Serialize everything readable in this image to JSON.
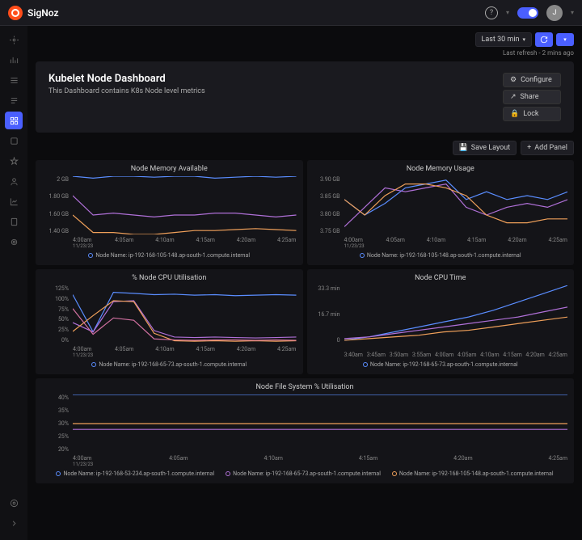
{
  "brand": "SigNoz",
  "avatar_initial": "J",
  "time_range": "Last 30 min",
  "last_refresh": "Last refresh - 2 mins ago",
  "dashboard": {
    "title": "Kubelet Node Dashboard",
    "subtitle": "This Dashboard contains K8s Node level metrics"
  },
  "actions": {
    "configure": "Configure",
    "share": "Share",
    "lock": "Lock",
    "save_layout": "Save Layout",
    "add_panel": "Add Panel"
  },
  "colors": {
    "blue": "#5a8dff",
    "purple": "#b070d8",
    "orange": "#f0a05a",
    "pink": "#d070a0"
  },
  "chart_data": [
    {
      "id": "mem_avail",
      "title": "Node Memory Available",
      "type": "line",
      "yticks": [
        "2 GB",
        "1.80 GB",
        "1.60 GB",
        "1.40 GB"
      ],
      "xticks": [
        "4:00am",
        "4:05am",
        "4:10am",
        "4:15am",
        "4:20am",
        "4:25am"
      ],
      "xdate": "11/23/23",
      "series": [
        {
          "name": "Node Name: ip-192-168-105-148.ap-south-1.compute.internal",
          "color": "blue",
          "values": [
            2.0,
            1.98,
            2.0,
            2.0,
            1.99,
            2.0,
            2.0,
            1.98,
            1.99,
            2.0,
            1.99,
            2.0
          ]
        },
        {
          "name": "",
          "color": "purple",
          "values": [
            1.8,
            1.6,
            1.62,
            1.6,
            1.58,
            1.6,
            1.6,
            1.62,
            1.62,
            1.6,
            1.58,
            1.6
          ]
        },
        {
          "name": "",
          "color": "orange",
          "values": [
            1.6,
            1.42,
            1.42,
            1.4,
            1.4,
            1.42,
            1.44,
            1.44,
            1.45,
            1.46,
            1.45,
            1.44
          ]
        }
      ],
      "ymin": 1.4,
      "ymax": 2.0
    },
    {
      "id": "mem_usage",
      "title": "Node Memory Usage",
      "type": "line",
      "yticks": [
        "3.90 GB",
        "3.85 GB",
        "3.80 GB",
        "3.75 GB"
      ],
      "xticks": [
        "4:00am",
        "4:05am",
        "4:10am",
        "4:15am",
        "4:20am",
        "4:25am"
      ],
      "xdate": "11/23/23",
      "series": [
        {
          "name": "Node Name: ip-192-168-105-148.ap-south-1.compute.internal",
          "color": "blue",
          "values": [
            3.84,
            3.8,
            3.83,
            3.87,
            3.88,
            3.89,
            3.84,
            3.86,
            3.84,
            3.85,
            3.84,
            3.86
          ]
        },
        {
          "name": "",
          "color": "purple",
          "values": [
            3.77,
            3.82,
            3.87,
            3.86,
            3.87,
            3.88,
            3.82,
            3.8,
            3.82,
            3.83,
            3.82,
            3.84
          ]
        },
        {
          "name": "",
          "color": "orange",
          "values": [
            3.84,
            3.8,
            3.85,
            3.88,
            3.88,
            3.87,
            3.85,
            3.8,
            3.78,
            3.78,
            3.79,
            3.79
          ]
        }
      ],
      "ymin": 3.75,
      "ymax": 3.9
    },
    {
      "id": "cpu_util",
      "title": "% Node CPU Utilisation",
      "type": "line",
      "yticks": [
        "125%",
        "100%",
        "75%",
        "50%",
        "25%",
        "0%"
      ],
      "xticks": [
        "4:00am",
        "4:05am",
        "4:10am",
        "4:15am",
        "4:20am",
        "4:25am"
      ],
      "xdate": "11/23/23",
      "series": [
        {
          "name": "Node Name: ip-192-168-65-73.ap-south-1.compute.internal",
          "color": "blue",
          "values": [
            105,
            25,
            110,
            108,
            105,
            106,
            104,
            105,
            103,
            104,
            105,
            104
          ]
        },
        {
          "name": "",
          "color": "purple",
          "values": [
            45,
            25,
            90,
            92,
            28,
            14,
            13,
            14,
            13,
            12,
            13,
            14
          ]
        },
        {
          "name": "",
          "color": "orange",
          "values": [
            26,
            60,
            92,
            90,
            22,
            6,
            5,
            6,
            5,
            6,
            5,
            6
          ]
        },
        {
          "name": "",
          "color": "pink",
          "values": [
            75,
            20,
            55,
            50,
            10,
            8,
            7,
            8,
            8,
            7,
            8,
            7
          ]
        }
      ],
      "ymin": 0,
      "ymax": 125
    },
    {
      "id": "cpu_time",
      "title": "Node CPU Time",
      "type": "line",
      "yticks": [
        "33.3 min",
        "16.7 min",
        "0"
      ],
      "xticks": [
        "3:40am",
        "3:45am",
        "3:50am",
        "3:55am",
        "4:00am",
        "4:05am",
        "4:10am",
        "4:15am",
        "4:20am",
        "4:25am"
      ],
      "series": [
        {
          "name": "Node Name: ip-192-168-65-73.ap-south-1.compute.internal",
          "color": "blue",
          "values": [
            2,
            4,
            7,
            10,
            13,
            16,
            20,
            25,
            30,
            35
          ]
        },
        {
          "name": "",
          "color": "purple",
          "values": [
            3,
            4,
            6,
            8,
            10,
            12,
            14,
            16,
            19,
            22
          ]
        },
        {
          "name": "",
          "color": "orange",
          "values": [
            2,
            3,
            4,
            5,
            7,
            8,
            10,
            12,
            14,
            16
          ]
        }
      ],
      "ymin": 0,
      "ymax": 35
    },
    {
      "id": "fs_util",
      "title": "Node File System % Utilisation",
      "type": "line",
      "yticks": [
        "40%",
        "35%",
        "30%",
        "25%",
        "20%"
      ],
      "xticks": [
        "4:00am",
        "4:05am",
        "4:10am",
        "4:15am",
        "4:20am",
        "4:25am"
      ],
      "xdate": "11/23/23",
      "series": [
        {
          "name": "Node Name: ip-192-168-53-234.ap-south-1.compute.internal",
          "color": "blue",
          "values": [
            40,
            40,
            40,
            40,
            40,
            40,
            40,
            40,
            40,
            40,
            40,
            40
          ]
        },
        {
          "name": "Node Name: ip-192-168-65-73.ap-south-1.compute.internal",
          "color": "purple",
          "values": [
            28,
            28,
            28,
            28,
            28,
            28,
            28,
            28,
            28,
            28,
            28,
            28
          ]
        },
        {
          "name": "Node Name: ip-192-168-105-148.ap-south-1.compute.internal",
          "color": "orange",
          "values": [
            30,
            30,
            30,
            30,
            30,
            30,
            30,
            30,
            30,
            30,
            30,
            30
          ]
        }
      ],
      "ymin": 20,
      "ymax": 40
    }
  ]
}
